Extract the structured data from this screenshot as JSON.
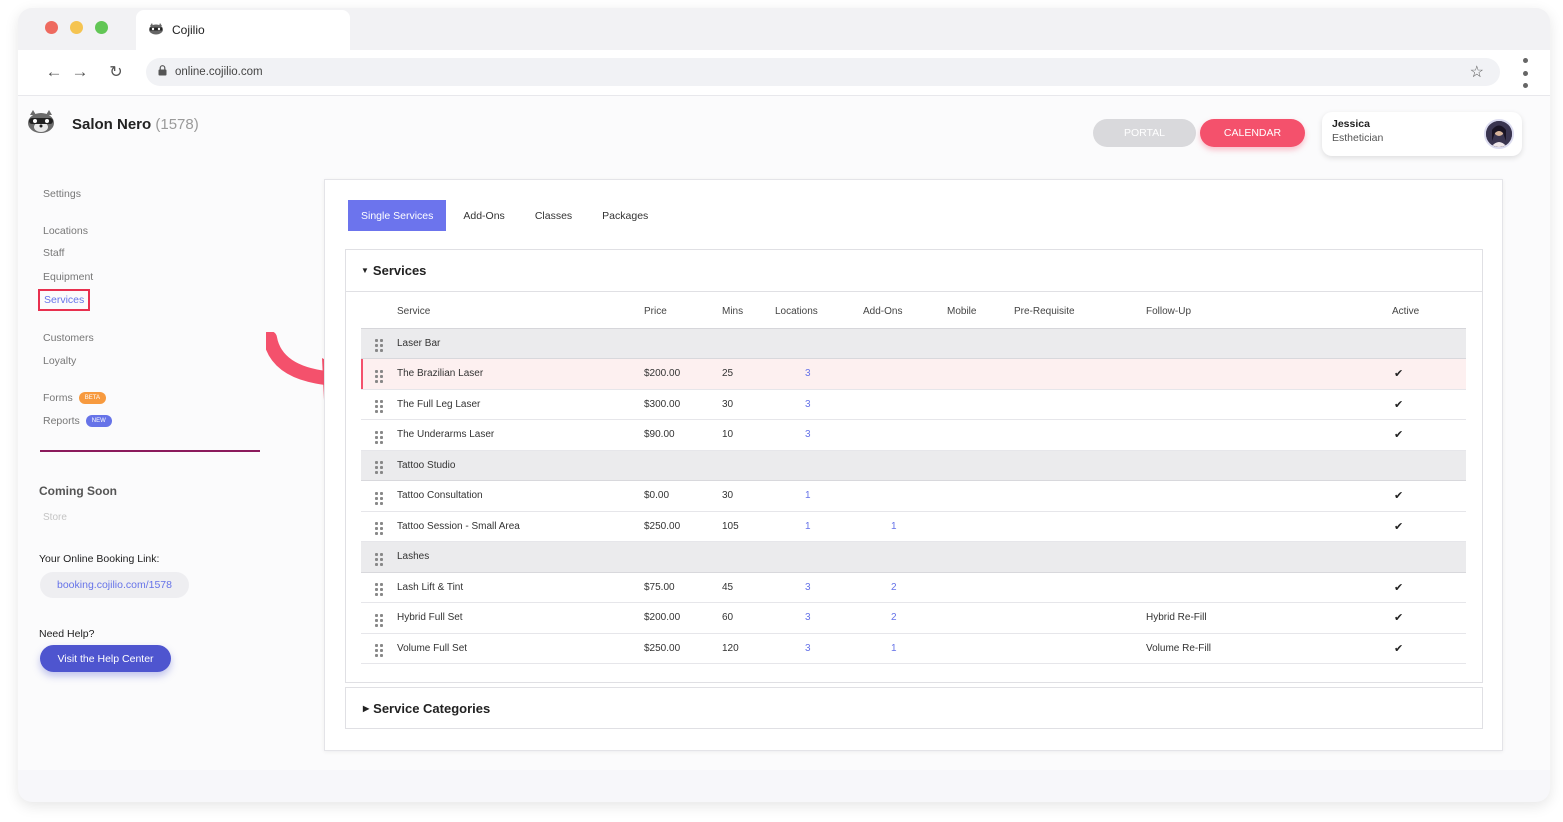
{
  "browser": {
    "tab_title": "Cojilio",
    "url": "online.cojilio.com"
  },
  "header": {
    "business_name": "Salon Nero",
    "business_id": "(1578)",
    "portal_label": "PORTAL",
    "calendar_label": "CALENDAR",
    "user_name": "Jessica",
    "user_role": "Esthetician"
  },
  "sidebar": {
    "settings": "Settings",
    "locations": "Locations",
    "staff": "Staff",
    "equipment": "Equipment",
    "services": "Services",
    "customers": "Customers",
    "loyalty": "Loyalty",
    "forms": "Forms",
    "forms_badge": "BETA",
    "reports": "Reports",
    "reports_badge": "NEW",
    "coming_soon": "Coming Soon",
    "store": "Store",
    "booking_label": "Your Online Booking Link:",
    "booking_link": "booking.cojilio.com/1578",
    "help_label": "Need Help?",
    "help_button": "Visit the Help Center"
  },
  "subtabs": [
    "Single Services",
    "Add-Ons",
    "Classes",
    "Packages"
  ],
  "services_section": {
    "title": "Services",
    "columns": [
      "Service",
      "Price",
      "Mins",
      "Locations",
      "Add-Ons",
      "Mobile",
      "Pre-Requisite",
      "Follow-Up",
      "Active"
    ],
    "rows": [
      {
        "type": "category",
        "name": "Laser Bar"
      },
      {
        "type": "service",
        "name": "The Brazilian Laser",
        "price": "$200.00",
        "mins": "25",
        "locations": "3",
        "addons": "",
        "mobile": "",
        "prereq": "",
        "followup": "",
        "active": "✔",
        "highlight": true
      },
      {
        "type": "service",
        "name": "The Full Leg Laser",
        "price": "$300.00",
        "mins": "30",
        "locations": "3",
        "addons": "",
        "mobile": "",
        "prereq": "",
        "followup": "",
        "active": "✔"
      },
      {
        "type": "service",
        "name": "The Underarms Laser",
        "price": "$90.00",
        "mins": "10",
        "locations": "3",
        "addons": "",
        "mobile": "",
        "prereq": "",
        "followup": "",
        "active": "✔"
      },
      {
        "type": "category",
        "name": "Tattoo Studio"
      },
      {
        "type": "service",
        "name": "Tattoo Consultation",
        "price": "$0.00",
        "mins": "30",
        "locations": "1",
        "addons": "",
        "mobile": "",
        "prereq": "",
        "followup": "",
        "active": "✔"
      },
      {
        "type": "service",
        "name": "Tattoo Session - Small Area",
        "price": "$250.00",
        "mins": "105",
        "locations": "1",
        "addons": "1",
        "mobile": "",
        "prereq": "",
        "followup": "",
        "active": "✔"
      },
      {
        "type": "category",
        "name": "Lashes"
      },
      {
        "type": "service",
        "name": "Lash Lift & Tint",
        "price": "$75.00",
        "mins": "45",
        "locations": "3",
        "addons": "2",
        "mobile": "",
        "prereq": "",
        "followup": "",
        "active": "✔"
      },
      {
        "type": "service",
        "name": "Hybrid Full Set",
        "price": "$200.00",
        "mins": "60",
        "locations": "3",
        "addons": "2",
        "mobile": "",
        "prereq": "",
        "followup": "Hybrid Re-Fill",
        "active": "✔"
      },
      {
        "type": "service",
        "name": "Volume Full Set",
        "price": "$250.00",
        "mins": "120",
        "locations": "3",
        "addons": "1",
        "mobile": "",
        "prereq": "",
        "followup": "Volume Re-Fill",
        "active": "✔"
      }
    ]
  },
  "categories_section": {
    "title": "Service Categories"
  },
  "colors": {
    "accent": "#6c74ed",
    "calendar": "#f4516c",
    "highlight_outline": "#e8304f"
  }
}
